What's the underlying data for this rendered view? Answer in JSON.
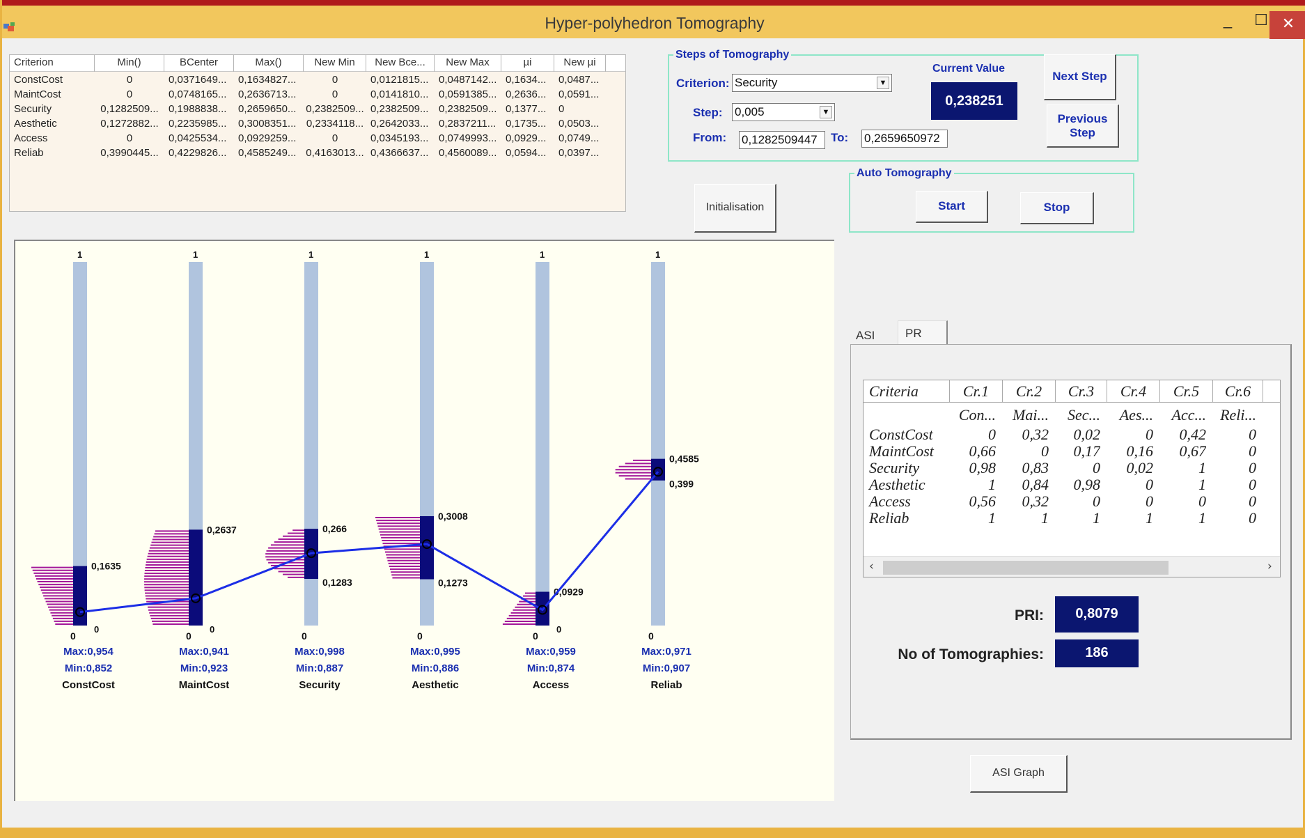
{
  "window": {
    "title": "Hyper-polyhedron Tomography",
    "minimize_glyph": "_",
    "maximize_glyph": "☐",
    "close_glyph": "✕"
  },
  "grid": {
    "columns": [
      "Criterion",
      "Min()",
      "BCenter",
      "Max()",
      "New Min",
      "New Bce...",
      "New Max",
      "µi",
      "New µi"
    ],
    "rows": [
      [
        "ConstCost",
        "0",
        "0,0371649...",
        "0,1634827...",
        "0",
        "0,0121815...",
        "0,0487142...",
        "0,1634...",
        "0,0487..."
      ],
      [
        "MaintCost",
        "0",
        "0,0748165...",
        "0,2636713...",
        "0",
        "0,0141810...",
        "0,0591385...",
        "0,2636...",
        "0,0591..."
      ],
      [
        "Security",
        "0,1282509...",
        "0,1988838...",
        "0,2659650...",
        "0,2382509...",
        "0,2382509...",
        "0,2382509...",
        "0,1377...",
        "0"
      ],
      [
        "Aesthetic",
        "0,1272882...",
        "0,2235985...",
        "0,3008351...",
        "0,2334118...",
        "0,2642033...",
        "0,2837211...",
        "0,1735...",
        "0,0503..."
      ],
      [
        "Access",
        "0",
        "0,0425534...",
        "0,0929259...",
        "0",
        "0,0345193...",
        "0,0749993...",
        "0,0929...",
        "0,0749..."
      ],
      [
        "Reliab",
        "0,3990445...",
        "0,4229826...",
        "0,4585249...",
        "0,4163013...",
        "0,4366637...",
        "0,4560089...",
        "0,0594...",
        "0,0397..."
      ]
    ]
  },
  "steps": {
    "group_title": "Steps of Tomography",
    "criterion_label": "Criterion:",
    "criterion_value": "Security",
    "step_label": "Step:",
    "step_value": "0,005",
    "from_label": "From:",
    "from_value": "0,1282509447",
    "to_label": "To:",
    "to_value": "0,2659650972",
    "current_value_label": "Current Value",
    "current_value": "0,238251",
    "next_step": "Next Step",
    "previous_step_1": "Previous",
    "previous_step_2": "Step"
  },
  "initialisation_button": "Initialisation",
  "auto": {
    "group_title": "Auto Tomography",
    "start": "Start",
    "stop": "Stop"
  },
  "axes": [
    {
      "name": "ConstCost",
      "top_label": "1",
      "bottom_label": "0",
      "zero_label": "0",
      "max_text": "Max:0,954",
      "min_text": "Min:0,852",
      "upper": 0.1635,
      "lower": 0.0,
      "upper_label": "0,1635",
      "lower_label": "",
      "point": 0.037
    },
    {
      "name": "MaintCost",
      "top_label": "1",
      "bottom_label": "0",
      "zero_label": "0",
      "max_text": "Max:0,941",
      "min_text": "Min:0,923",
      "upper": 0.2637,
      "lower": 0.0,
      "upper_label": "0,2637",
      "lower_label": "",
      "point": 0.075
    },
    {
      "name": "Security",
      "top_label": "1",
      "bottom_label": "0",
      "zero_label": "",
      "max_text": "Max:0,998",
      "min_text": "Min:0,887",
      "upper": 0.266,
      "lower": 0.1283,
      "upper_label": "0,266",
      "lower_label": "0,1283",
      "point": 0.199
    },
    {
      "name": "Aesthetic",
      "top_label": "1",
      "bottom_label": "0",
      "zero_label": "",
      "max_text": "Max:0,995",
      "min_text": "Min:0,886",
      "upper": 0.3008,
      "lower": 0.1273,
      "upper_label": "0,3008",
      "lower_label": "0,1273",
      "point": 0.224
    },
    {
      "name": "Access",
      "top_label": "1",
      "bottom_label": "0",
      "zero_label": "0",
      "max_text": "Max:0,959",
      "min_text": "Min:0,874",
      "upper": 0.0929,
      "lower": 0.0,
      "upper_label": "0,0929",
      "lower_label": "",
      "point": 0.043
    },
    {
      "name": "Reliab",
      "top_label": "1",
      "bottom_label": "0",
      "zero_label": "",
      "max_text": "Max:0,971",
      "min_text": "Min:0,907",
      "upper": 0.4585,
      "lower": 0.399,
      "upper_label": "0,4585",
      "lower_label": "0,399",
      "point": 0.423
    }
  ],
  "colors": {
    "axis_bar": "#b0c4de",
    "range_bar": "#0b0b7a",
    "hatch": "#a3179a",
    "line": "#1c2ee6",
    "max_min_text": "#1a2fb0",
    "value_box": "#0b1670"
  },
  "tabs": {
    "asi": "ASI",
    "pr": "PR",
    "active": "PR"
  },
  "matrix": {
    "headers": [
      "Criteria",
      "Cr.1",
      "Cr.2",
      "Cr.3",
      "Cr.4",
      "Cr.5",
      "Cr.6"
    ],
    "subheaders": [
      "",
      "Con...",
      "Mai...",
      "Sec...",
      "Aes...",
      "Acc...",
      "Reli..."
    ],
    "rows": [
      [
        "ConstCost",
        "0",
        "0,32",
        "0,02",
        "0",
        "0,42",
        "0"
      ],
      [
        "MaintCost",
        "0,66",
        "0",
        "0,17",
        "0,16",
        "0,67",
        "0"
      ],
      [
        "Security",
        "0,98",
        "0,83",
        "0",
        "0,02",
        "1",
        "0"
      ],
      [
        "Aesthetic",
        "1",
        "0,84",
        "0,98",
        "0",
        "1",
        "0"
      ],
      [
        "Access",
        "0,56",
        "0,32",
        "0",
        "0",
        "0",
        "0"
      ],
      [
        "Reliab",
        "1",
        "1",
        "1",
        "1",
        "1",
        "0"
      ]
    ]
  },
  "pri": {
    "label": "PRI:",
    "value": "0,8079"
  },
  "tomographies": {
    "label": "No of Tomographies:",
    "value": "186"
  },
  "asi_graph_button": "ASI Graph"
}
